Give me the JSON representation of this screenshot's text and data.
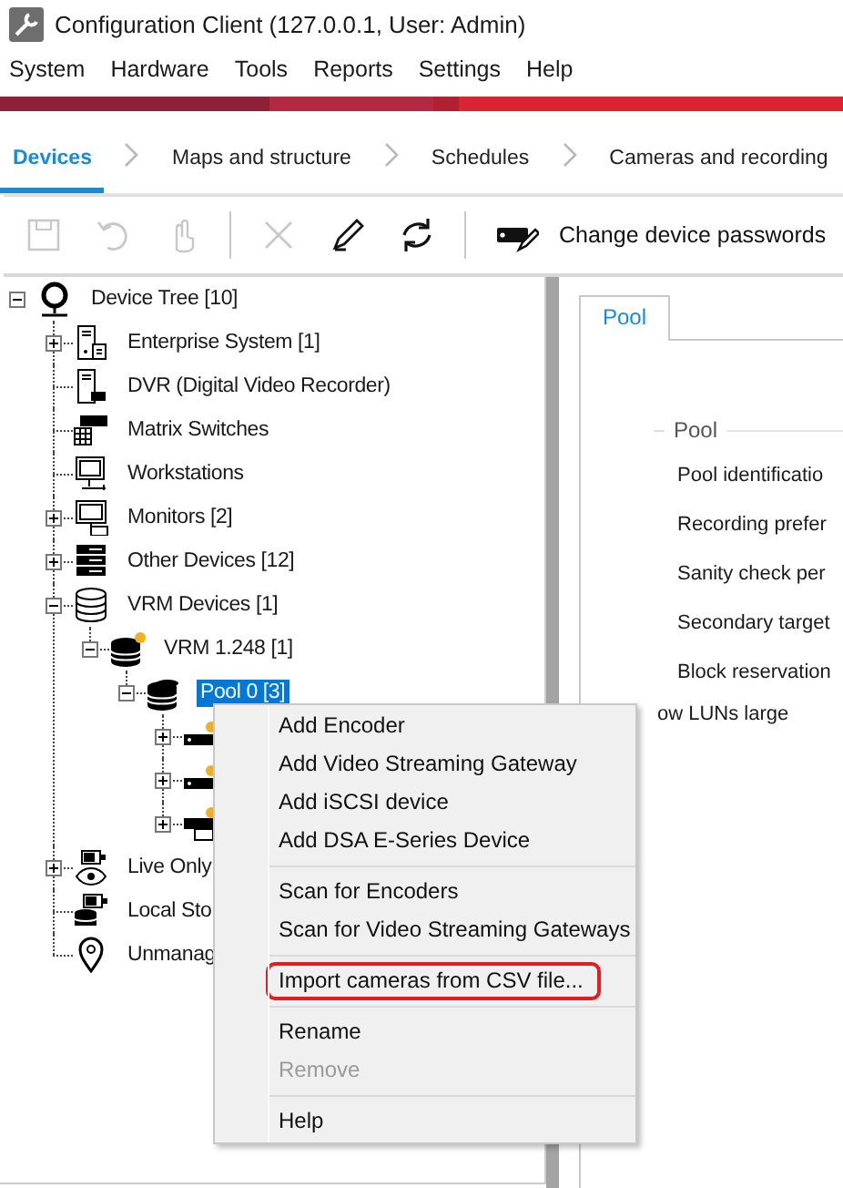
{
  "window": {
    "title": "Configuration Client (127.0.0.1, User: Admin)"
  },
  "menu_bar": [
    "System",
    "Hardware",
    "Tools",
    "Reports",
    "Settings",
    "Help"
  ],
  "steps": [
    {
      "label": "Devices",
      "selected": true
    },
    {
      "label": "Maps and structure",
      "selected": false
    },
    {
      "label": "Schedules",
      "selected": false
    },
    {
      "label": "Cameras and recording",
      "selected": false
    }
  ],
  "toolbar": [
    {
      "kind": "save",
      "disabled": true
    },
    {
      "kind": "undo",
      "disabled": true
    },
    {
      "kind": "hand",
      "disabled": true
    },
    {
      "kind": "separator"
    },
    {
      "kind": "delete",
      "disabled": true
    },
    {
      "kind": "edit",
      "disabled": false
    },
    {
      "kind": "refresh",
      "disabled": false
    },
    {
      "kind": "separator"
    },
    {
      "kind": "passwords",
      "label": "Change device passwords",
      "disabled": false
    }
  ],
  "device_tree": {
    "label": "Device Tree [10]",
    "kind": "root",
    "expanded": true,
    "selected": false,
    "children": [
      {
        "label": "Enterprise System [1]",
        "kind": "server",
        "expanded": false,
        "selected": false
      },
      {
        "label": "DVR (Digital Video Recorder)",
        "kind": "dvr",
        "selected": false
      },
      {
        "label": "Matrix Switches",
        "kind": "matrix",
        "selected": false
      },
      {
        "label": "Workstations",
        "kind": "workstation",
        "selected": false
      },
      {
        "label": "Monitors [2]",
        "kind": "monitor",
        "expanded": false,
        "selected": false
      },
      {
        "label": "Other Devices [12]",
        "kind": "rack",
        "expanded": false,
        "selected": false
      },
      {
        "label": "VRM Devices [1]",
        "kind": "storage",
        "expanded": true,
        "selected": false,
        "children": [
          {
            "label": "VRM 1.248 [1]",
            "kind": "vrm",
            "expanded": true,
            "selected": false,
            "children": [
              {
                "label": "Pool 0 [3]",
                "kind": "pool",
                "expanded": true,
                "selected": true,
                "children": [
                  {
                    "kind": "encoder",
                    "expanded": false
                  },
                  {
                    "kind": "encoder",
                    "expanded": false
                  },
                  {
                    "kind": "gateway",
                    "expanded": false
                  }
                ]
              }
            ]
          }
        ]
      },
      {
        "label": "Live Only",
        "kind": "liveonly",
        "expanded": false,
        "selected": false
      },
      {
        "label": "Local Sto",
        "kind": "localstorage",
        "selected": false
      },
      {
        "label": "Unmanag",
        "kind": "location",
        "selected": false
      }
    ]
  },
  "pool_panel": {
    "tabs": [
      {
        "label": "Pool",
        "selected": true
      }
    ],
    "group": "Pool",
    "labels": [
      {
        "text": "Pool identificatio",
        "kind": "open"
      },
      {
        "text": "Recording prefer",
        "kind": "open"
      },
      {
        "text": "Sanity check per",
        "kind": "open"
      },
      {
        "text": "Secondary target",
        "kind": "open"
      },
      {
        "text": "Block reservation",
        "kind": "open"
      },
      {
        "text": "ow LUNs large",
        "kind": "covered"
      }
    ]
  },
  "context_menu": [
    {
      "kind": "item",
      "label": "Add Encoder",
      "disabled": false,
      "outlined": false
    },
    {
      "kind": "item",
      "label": "Add Video Streaming Gateway",
      "disabled": false,
      "outlined": false
    },
    {
      "kind": "item",
      "label": "Add iSCSI device",
      "disabled": false,
      "outlined": false
    },
    {
      "kind": "item",
      "label": "Add DSA E-Series Device",
      "disabled": false,
      "outlined": false
    },
    {
      "kind": "separator"
    },
    {
      "kind": "item",
      "label": "Scan for Encoders",
      "disabled": false,
      "outlined": false
    },
    {
      "kind": "item",
      "label": "Scan for Video Streaming Gateways",
      "disabled": false,
      "outlined": false
    },
    {
      "kind": "separator"
    },
    {
      "kind": "item",
      "label": "Import cameras from CSV file...",
      "disabled": false,
      "outlined": true
    },
    {
      "kind": "separator"
    },
    {
      "kind": "item",
      "label": "Rename",
      "disabled": false,
      "outlined": false
    },
    {
      "kind": "item",
      "label": "Remove",
      "disabled": true,
      "outlined": false
    },
    {
      "kind": "separator"
    },
    {
      "kind": "item",
      "label": "Help",
      "disabled": false,
      "outlined": false
    }
  ]
}
